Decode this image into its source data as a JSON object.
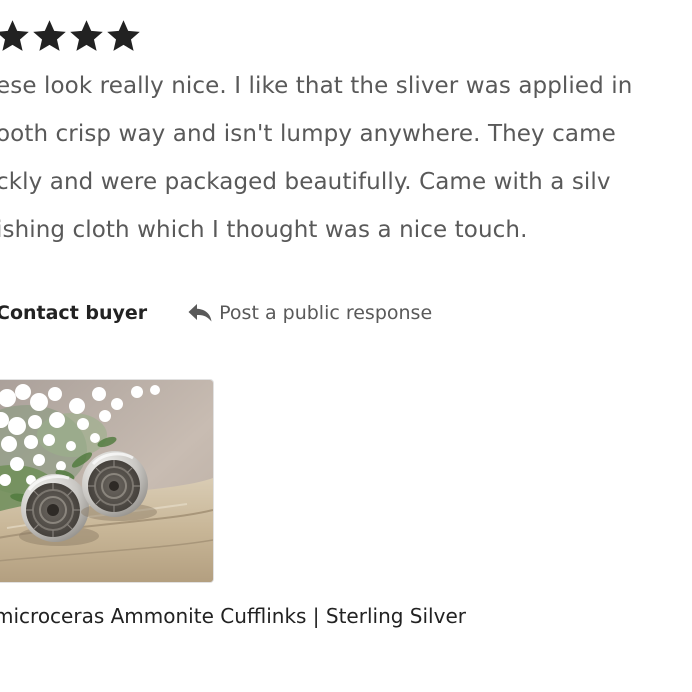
{
  "rating": {
    "stars": 4,
    "icon": "star-icon",
    "color": "#222222"
  },
  "review": {
    "lines": [
      "ese look really nice. I like that the sliver was applied in",
      "ooth crisp way and isn't lumpy anywhere. They came",
      "ckly and were packaged beautifully. Came with a silv",
      "ishing cloth which I thought was a nice touch."
    ],
    "text_color": "#595959"
  },
  "actions": {
    "contact_label": "Contact buyer",
    "respond_label": "Post a public response",
    "respond_icon": "reply-arrow-icon"
  },
  "product": {
    "title": "microceras Ammonite Cufflinks | Sterling Silver",
    "image_icon": "ammonite-cufflinks-photo"
  }
}
